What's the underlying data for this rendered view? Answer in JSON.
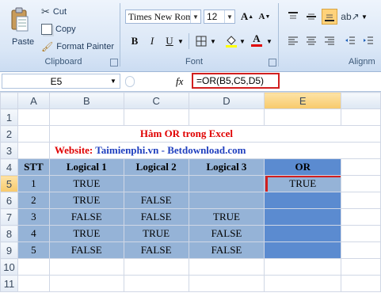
{
  "clipboard": {
    "paste_label": "Paste",
    "cut_label": "Cut",
    "copy_label": "Copy",
    "format_painter_label": "Format Painter",
    "group_label": "Clipboard"
  },
  "font": {
    "font_name": "Times New Rom",
    "font_size": "12",
    "group_label": "Font",
    "bold": "B",
    "italic": "I",
    "underline": "U",
    "font_color_letter": "A"
  },
  "alignment": {
    "group_label": "Alignm"
  },
  "formula_bar": {
    "cell_ref": "E5",
    "fx_label": "fx",
    "formula": "=OR(B5,C5,D5)"
  },
  "sheet": {
    "columns": [
      "A",
      "B",
      "C",
      "D",
      "E"
    ],
    "rows": [
      "1",
      "2",
      "3",
      "4",
      "5",
      "6",
      "7",
      "8",
      "9",
      "10",
      "11"
    ],
    "title": "Hàm OR trong Excel",
    "website_prefix": "Website:",
    "website_text": "Taimienphi.vn - Betdownload.com",
    "headers": [
      "STT",
      "Logical 1",
      "Logical 2",
      "Logical 3",
      "OR"
    ],
    "data": [
      [
        "1",
        "TRUE",
        "",
        "",
        "TRUE"
      ],
      [
        "2",
        "TRUE",
        "FALSE",
        "",
        ""
      ],
      [
        "3",
        "FALSE",
        "FALSE",
        "TRUE",
        ""
      ],
      [
        "4",
        "TRUE",
        "TRUE",
        "FALSE",
        ""
      ],
      [
        "5",
        "FALSE",
        "FALSE",
        "FALSE",
        ""
      ]
    ]
  },
  "colors": {
    "header_fill": "#95b3d7",
    "or_fill": "#5b8bd0",
    "title_red": "#e00000",
    "website_blue": "#1f3fbf",
    "highlight_red": "#d11f1f"
  }
}
